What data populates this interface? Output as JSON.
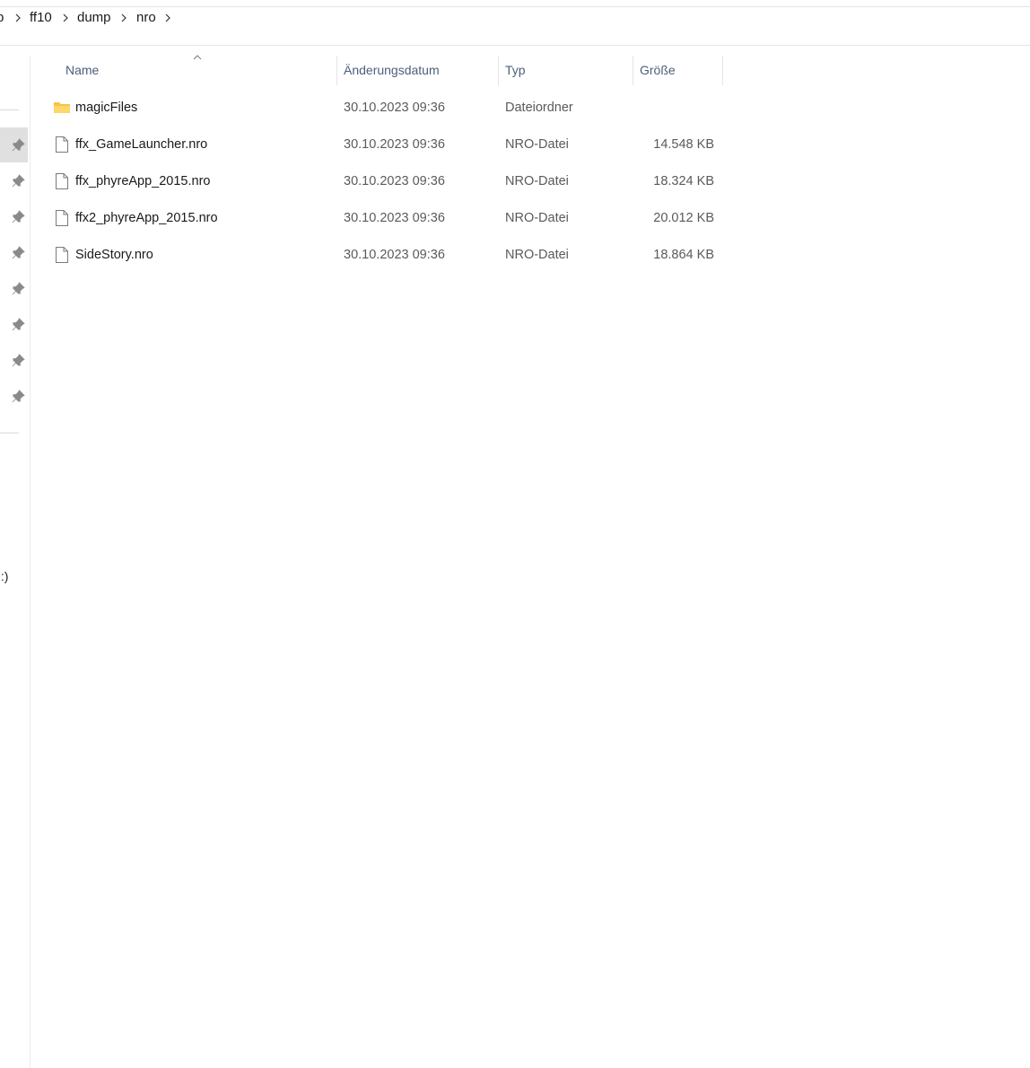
{
  "breadcrumb": {
    "leading_fragment": "p",
    "items": [
      "ff10",
      "dump",
      "nro"
    ]
  },
  "sidebar": {
    "pin_count": 8,
    "drive_fragment": "!:)"
  },
  "columns": {
    "name": "Name",
    "date": "Änderungsdatum",
    "type": "Typ",
    "size": "Größe"
  },
  "files": [
    {
      "name": "magicFiles",
      "date": "30.10.2023 09:36",
      "type": "Dateiordner",
      "size": "",
      "icon": "folder-icon"
    },
    {
      "name": "ffx_GameLauncher.nro",
      "date": "30.10.2023 09:36",
      "type": "NRO-Datei",
      "size": "14.548 KB",
      "icon": "file-icon"
    },
    {
      "name": "ffx_phyreApp_2015.nro",
      "date": "30.10.2023 09:36",
      "type": "NRO-Datei",
      "size": "18.324 KB",
      "icon": "file-icon"
    },
    {
      "name": "ffx2_phyreApp_2015.nro",
      "date": "30.10.2023 09:36",
      "type": "NRO-Datei",
      "size": "20.012 KB",
      "icon": "file-icon"
    },
    {
      "name": "SideStory.nro",
      "date": "30.10.2023 09:36",
      "type": "NRO-Datei",
      "size": "18.864 KB",
      "icon": "file-icon"
    }
  ],
  "colors": {
    "header_text": "#4c607a",
    "folder_yellow": "#f6c444",
    "selected_pin_bg": "#e0e0e0"
  }
}
